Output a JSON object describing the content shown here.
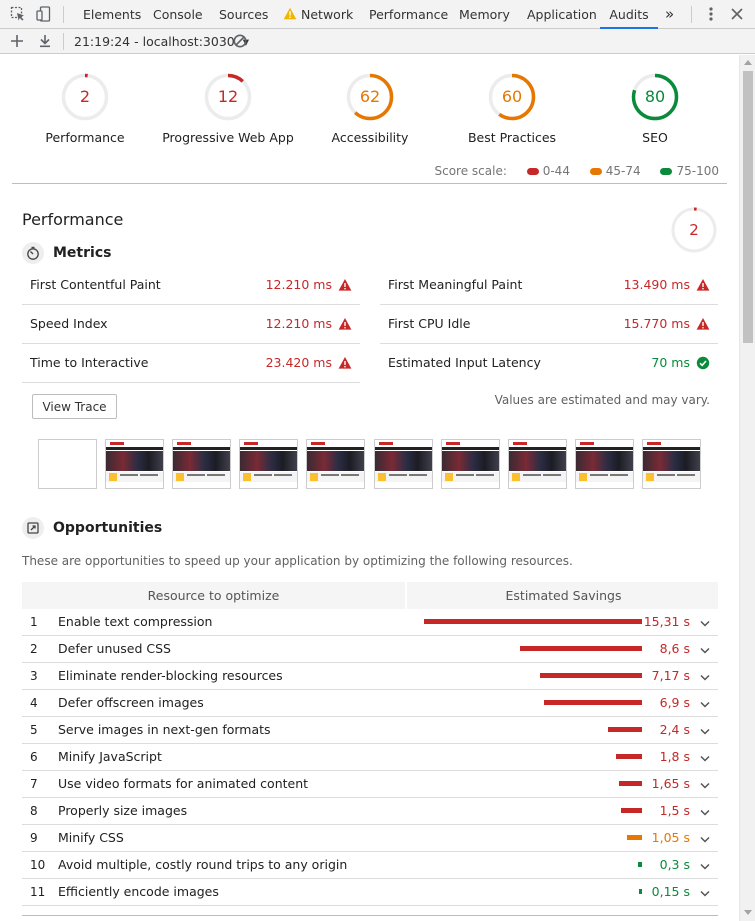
{
  "devtools": {
    "tabs": [
      {
        "label": "Elements",
        "active": false
      },
      {
        "label": "Console",
        "active": false
      },
      {
        "label": "Sources",
        "active": false
      },
      {
        "label": "Network",
        "active": false,
        "warning": true
      },
      {
        "label": "Performance",
        "active": false
      },
      {
        "label": "Memory",
        "active": false
      },
      {
        "label": "Application",
        "active": false
      },
      {
        "label": "Audits",
        "active": true
      }
    ],
    "overflow": "»",
    "toolbar": {
      "report_label": "21:19:24 - localhost:3030",
      "report_caret": "▾"
    }
  },
  "colors": {
    "fail": "#c62828",
    "average": "#e67700",
    "pass": "#0a8a3a",
    "accent": "#1a73e8"
  },
  "gauges": [
    {
      "score": "2",
      "value": 2,
      "label": "Performance",
      "status": "fail"
    },
    {
      "score": "12",
      "value": 12,
      "label": "Progressive Web App",
      "status": "fail"
    },
    {
      "score": "62",
      "value": 62,
      "label": "Accessibility",
      "status": "average"
    },
    {
      "score": "60",
      "value": 60,
      "label": "Best Practices",
      "status": "average"
    },
    {
      "score": "80",
      "value": 80,
      "label": "SEO",
      "status": "pass"
    }
  ],
  "score_scale": {
    "label": "Score scale:",
    "ranges": [
      {
        "label": "0-44",
        "status": "fail"
      },
      {
        "label": "45-74",
        "status": "average"
      },
      {
        "label": "75-100",
        "status": "pass"
      }
    ]
  },
  "performance": {
    "title": "Performance",
    "score": "2",
    "value": 2,
    "metrics_title": "Metrics",
    "metrics": [
      {
        "name": "First Contentful Paint",
        "value": "12.210 ms",
        "status": "fail"
      },
      {
        "name": "First Meaningful Paint",
        "value": "13.490 ms",
        "status": "fail"
      },
      {
        "name": "Speed Index",
        "value": "12.210 ms",
        "status": "fail"
      },
      {
        "name": "First CPU Idle",
        "value": "15.770 ms",
        "status": "fail"
      },
      {
        "name": "Time to Interactive",
        "value": "23.420 ms",
        "status": "fail"
      },
      {
        "name": "Estimated Input Latency",
        "value": "70 ms",
        "status": "pass"
      }
    ],
    "view_trace": "View Trace",
    "estimated_note": "Values are estimated and may vary.",
    "opportunities_title": "Opportunities",
    "opportunities_desc": "These are opportunities to speed up your application by optimizing the following resources.",
    "opp_headers": {
      "resource": "Resource to optimize",
      "savings": "Estimated Savings"
    },
    "opportunities": [
      {
        "index": "1",
        "title": "Enable text compression",
        "savings": "15,31 s",
        "seconds": 15.31,
        "status": "fail"
      },
      {
        "index": "2",
        "title": "Defer unused CSS",
        "savings": "8,6 s",
        "seconds": 8.6,
        "status": "fail"
      },
      {
        "index": "3",
        "title": "Eliminate render-blocking resources",
        "savings": "7,17 s",
        "seconds": 7.17,
        "status": "fail"
      },
      {
        "index": "4",
        "title": "Defer offscreen images",
        "savings": "6,9 s",
        "seconds": 6.9,
        "status": "fail"
      },
      {
        "index": "5",
        "title": "Serve images in next-gen formats",
        "savings": "2,4 s",
        "seconds": 2.4,
        "status": "fail"
      },
      {
        "index": "6",
        "title": "Minify JavaScript",
        "savings": "1,8 s",
        "seconds": 1.8,
        "status": "fail"
      },
      {
        "index": "7",
        "title": "Use video formats for animated content",
        "savings": "1,65 s",
        "seconds": 1.65,
        "status": "fail"
      },
      {
        "index": "8",
        "title": "Properly size images",
        "savings": "1,5 s",
        "seconds": 1.5,
        "status": "fail"
      },
      {
        "index": "9",
        "title": "Minify CSS",
        "savings": "1,05 s",
        "seconds": 1.05,
        "status": "average"
      },
      {
        "index": "10",
        "title": "Avoid multiple, costly round trips to any origin",
        "savings": "0,3 s",
        "seconds": 0.3,
        "status": "pass"
      },
      {
        "index": "11",
        "title": "Efficiently encode images",
        "savings": "0,15 s",
        "seconds": 0.15,
        "status": "pass"
      }
    ]
  }
}
